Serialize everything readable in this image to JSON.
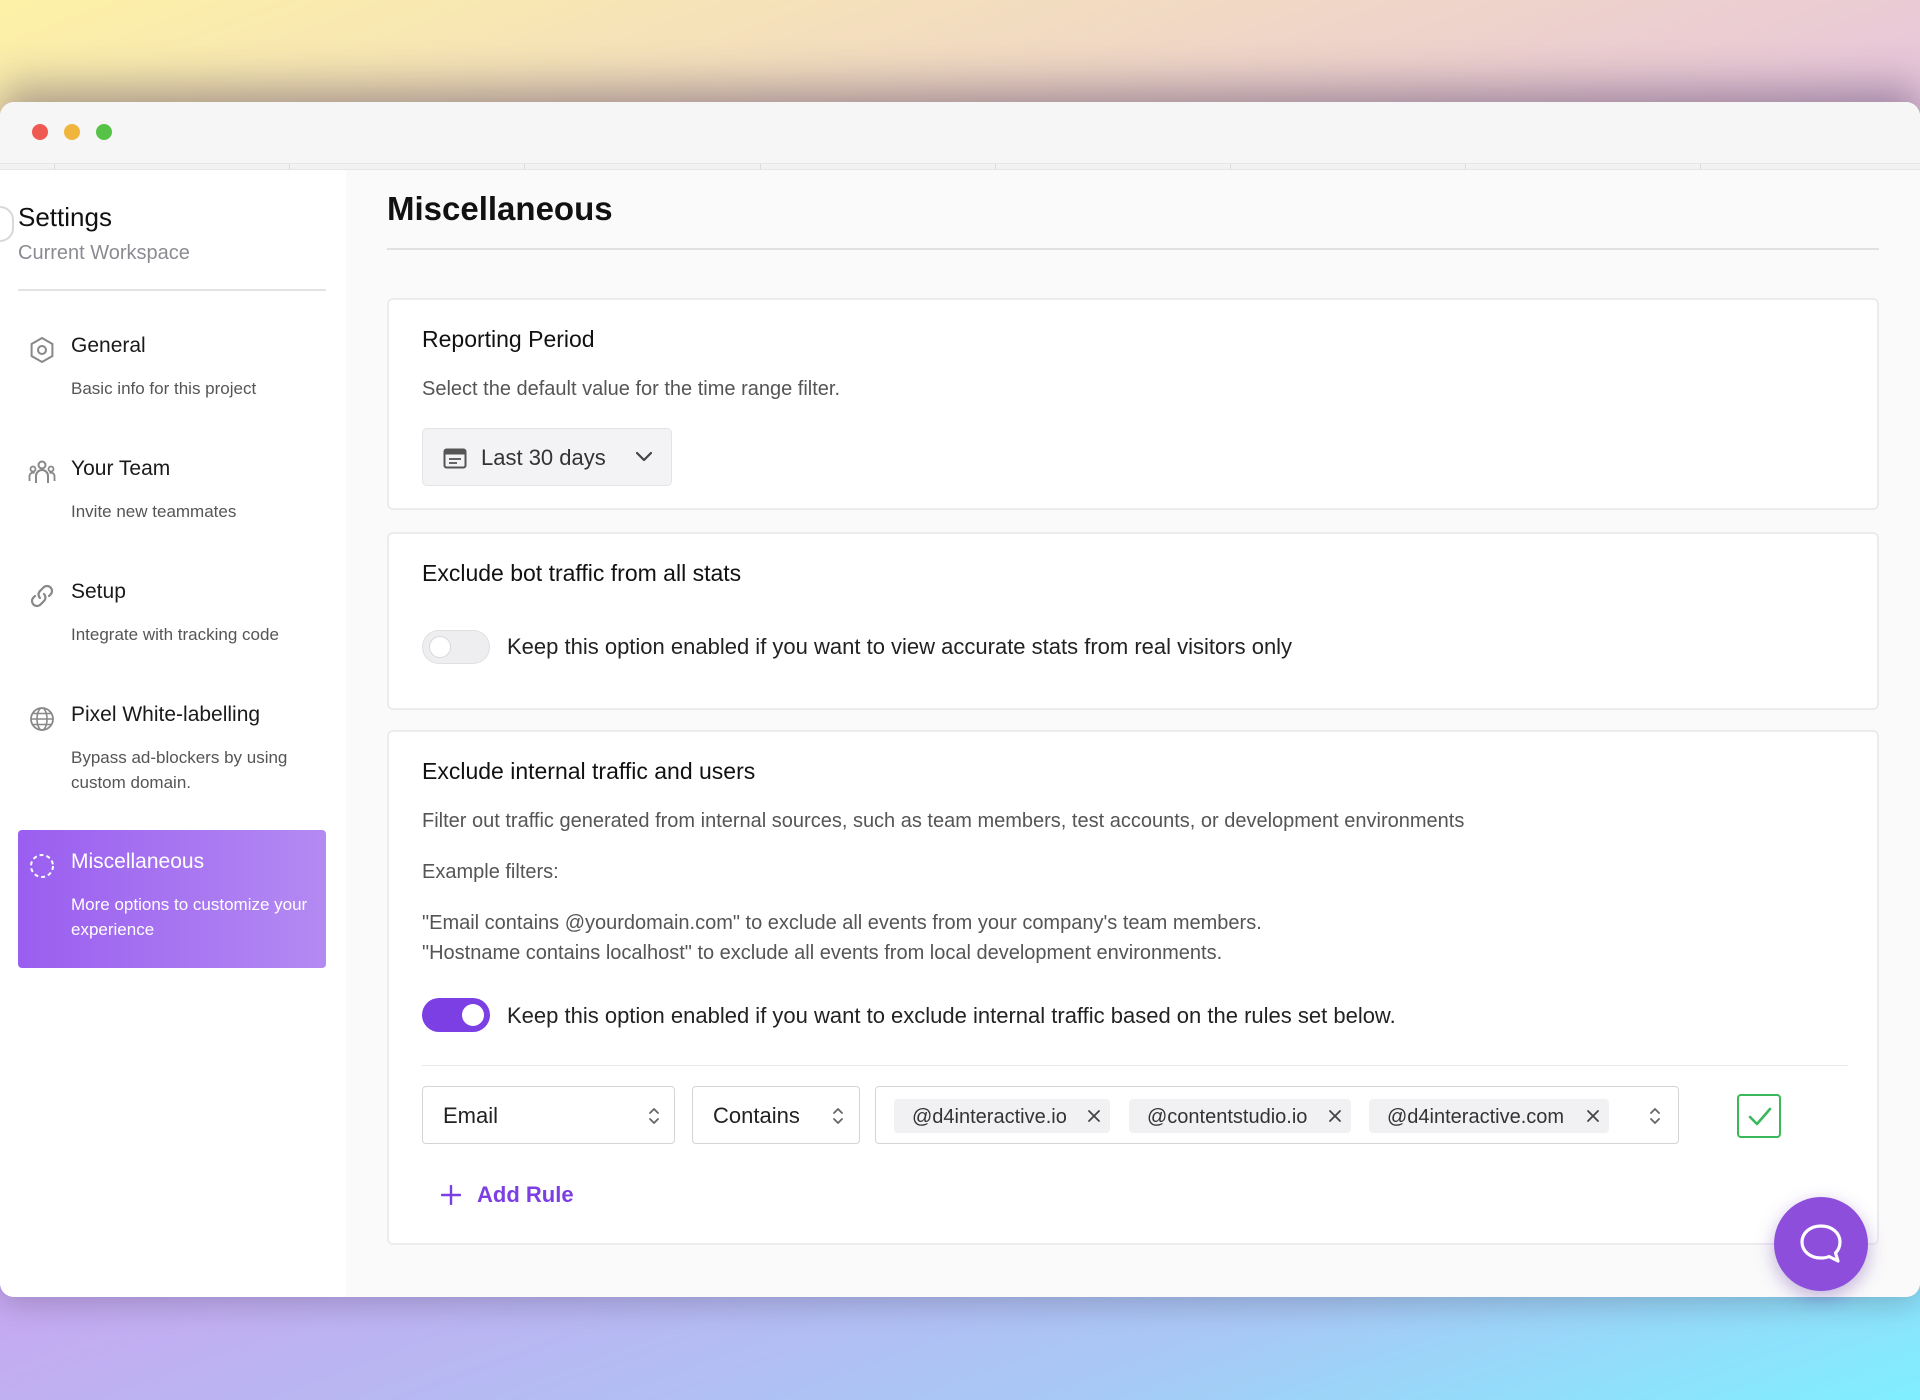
{
  "colors": {
    "accent": "#7b3fe4",
    "active_nav_gradient": [
      "#9a5ef0",
      "#b48af2"
    ],
    "confirm_green": "#3bb85c",
    "chat_button": "#8d4fdb"
  },
  "sidebar": {
    "title": "Settings",
    "subtitle": "Current Workspace",
    "items": [
      {
        "label": "General",
        "description": "Basic info for this project",
        "icon": "hexagon-settings-icon",
        "active": false
      },
      {
        "label": "Your Team",
        "description": "Invite new teammates",
        "icon": "team-icon",
        "active": false
      },
      {
        "label": "Setup",
        "description": "Integrate with tracking code",
        "icon": "link-icon",
        "active": false
      },
      {
        "label": "Pixel White-labelling",
        "description": "Bypass ad-blockers by using custom domain.",
        "icon": "globe-icon",
        "active": false
      },
      {
        "label": "Miscellaneous",
        "description": "More options to customize your experience",
        "icon": "dashed-circle-icon",
        "active": true
      }
    ]
  },
  "main": {
    "title": "Miscellaneous",
    "reporting": {
      "title": "Reporting Period",
      "description": "Select the default value for the time range filter.",
      "selected": "Last 30 days"
    },
    "bot_traffic": {
      "title": "Exclude bot traffic from all stats",
      "toggle_on": false,
      "toggle_label": "Keep this option enabled if you want to view accurate stats from real visitors only"
    },
    "internal_traffic": {
      "title": "Exclude internal traffic and users",
      "description": "Filter out traffic generated from internal sources, such as team members, test accounts, or development environments",
      "examples_heading": "Example filters:",
      "example_1": "\"Email contains @yourdomain.com\" to exclude all events from your company's team members.",
      "example_2": "\"Hostname contains localhost\" to exclude all events from local development environments.",
      "toggle_on": true,
      "toggle_label": "Keep this option enabled if you want to exclude internal traffic based on the rules set below.",
      "rule": {
        "field": "Email",
        "operator": "Contains",
        "values": [
          "@d4interactive.io",
          "@contentstudio.io",
          "@d4interactive.com"
        ]
      },
      "add_rule_label": "Add Rule"
    }
  },
  "chat": {
    "icon": "chat-bubble-icon"
  }
}
